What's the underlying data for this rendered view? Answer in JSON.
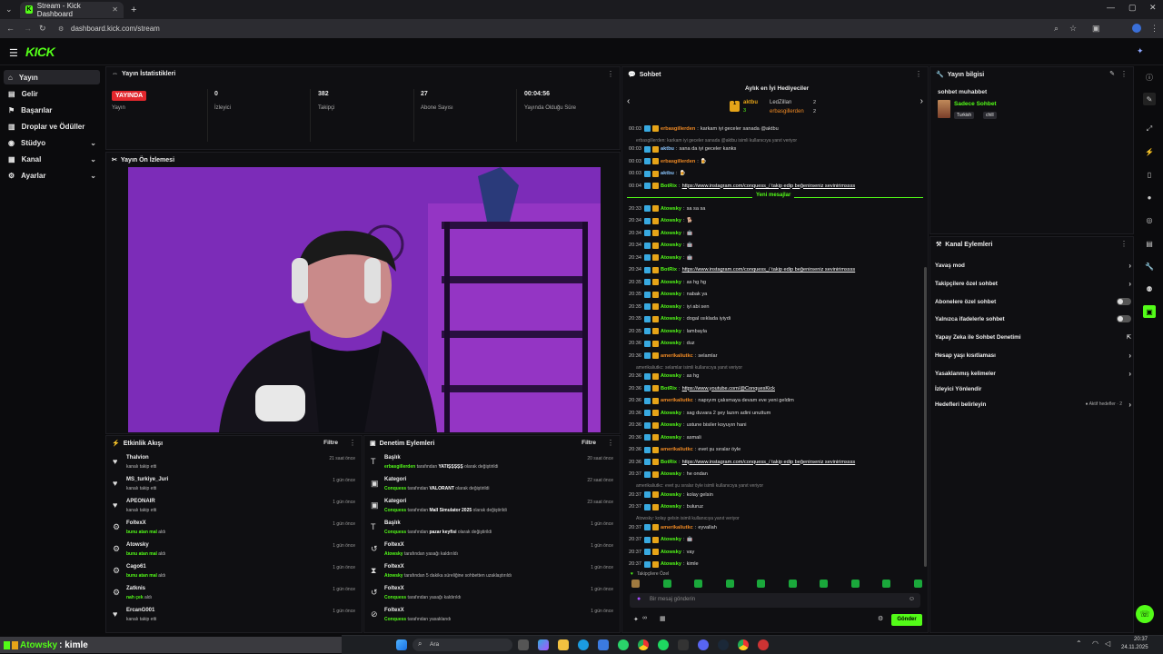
{
  "browser": {
    "tab_title": "Stream - Kick Dashboard",
    "url": "dashboard.kick.com/stream",
    "new_tab": "+"
  },
  "logo": "KICK",
  "sidebar": {
    "items": [
      {
        "label": "Yayın",
        "icon": "broadcast-icon"
      },
      {
        "label": "Gelir",
        "icon": "money-icon"
      },
      {
        "label": "Başarılar",
        "icon": "flag-icon"
      },
      {
        "label": "Droplar ve Ödüller",
        "icon": "gift-icon"
      },
      {
        "label": "Stüdyo",
        "icon": "studio-icon"
      },
      {
        "label": "Kanal",
        "icon": "channel-icon"
      },
      {
        "label": "Ayarlar",
        "icon": "settings-icon"
      }
    ]
  },
  "stats": {
    "title": "Yayın İstatistikleri",
    "live_badge": "YAYINDA",
    "items": [
      {
        "value": "",
        "label": "Yayın"
      },
      {
        "value": "0",
        "label": "İzleyici"
      },
      {
        "value": "382",
        "label": "Takipçi"
      },
      {
        "value": "27",
        "label": "Abone Sayısı"
      },
      {
        "value": "00:04:56",
        "label": "Yayında Olduğu Süre"
      }
    ]
  },
  "preview": {
    "title": "Yayın Ön İzlemesi"
  },
  "activity": {
    "title": "Etkinlik Akışı",
    "filter": "Filtre",
    "rows": [
      {
        "name": "Thalvion",
        "sub": "kanalı takip etti",
        "hl": "",
        "time": "21 saat önce",
        "icon": "♥"
      },
      {
        "name": "MS_turkiye_Juri",
        "sub": "kanalı takip etti",
        "hl": "",
        "time": "1 gün önce",
        "icon": "♥"
      },
      {
        "name": "APEONAIR",
        "sub": "kanalı takip etti",
        "hl": "",
        "time": "1 gün önce",
        "icon": "♥"
      },
      {
        "name": "FoltexX",
        "sub": " aldı",
        "hl": "bunu atan mal",
        "time": "1 gün önce",
        "icon": "⚙"
      },
      {
        "name": "Atowsky",
        "sub": " aldı",
        "hl": "bunu atan mal",
        "time": "1 gün önce",
        "icon": "⚙"
      },
      {
        "name": "Cago61",
        "sub": " aldı",
        "hl": "bunu atan mal",
        "time": "1 gün önce",
        "icon": "⚙"
      },
      {
        "name": "Zatknis",
        "sub": " aldı",
        "hl": "nah çek",
        "time": "1 gün önce",
        "icon": "⚙"
      },
      {
        "name": "ErcanG001",
        "sub": "kanalı takip etti",
        "hl": "",
        "time": "1 gün önce",
        "icon": "♥"
      }
    ]
  },
  "moderation": {
    "title": "Denetim Eylemleri",
    "filter": "Filtre",
    "rows": [
      {
        "name": "Başlık",
        "who": "erbasgillerden",
        "mid": " tarafından ",
        "val": "YATIŞŞŞŞŞ",
        "end": " olarak değiştirildi",
        "time": "20 saat önce",
        "icon": "T"
      },
      {
        "name": "Kategori",
        "who": "Conquess",
        "mid": " tarafından ",
        "val": "VALORANT",
        "end": " olarak değiştirildi",
        "time": "22 saat önce",
        "icon": "▣"
      },
      {
        "name": "Kategori",
        "who": "Conquess",
        "mid": " tarafından ",
        "val": "Mall Simulator 2025",
        "end": " olarak değiştirildi",
        "time": "23 saat önce",
        "icon": "▣"
      },
      {
        "name": "Başlık",
        "who": "Conquess",
        "mid": " tarafından ",
        "val": "pazar keyfisi",
        "end": " olarak değiştirildi",
        "time": "1 gün önce",
        "icon": "T"
      },
      {
        "name": "FoltexX",
        "who": "Atowsky",
        "mid": " tarafından yasağı kaldırıldı",
        "val": "",
        "end": "",
        "time": "1 gün önce",
        "icon": "↺"
      },
      {
        "name": "FoltexX",
        "who": "Atowsky",
        "mid": " tarafından 5 dakika süreliğine sohbetten uzaklaştırıldı",
        "val": "",
        "end": "",
        "time": "1 gün önce",
        "icon": "⧗"
      },
      {
        "name": "FoltexX",
        "who": "Conquess",
        "mid": " tarafından yasağı kaldırıldı",
        "val": "",
        "end": "",
        "time": "1 gün önce",
        "icon": "↺"
      },
      {
        "name": "FoltexX",
        "who": "Conquess",
        "mid": " tarafından yasaklandı",
        "val": "",
        "end": "",
        "time": "1 gün önce",
        "icon": "⊘"
      }
    ]
  },
  "chat": {
    "title": "Sohbet",
    "gifters_title": "Aylık en İyi Hediyeciler",
    "gifters": [
      {
        "name": "aktbu",
        "count": "3"
      },
      {
        "name": "LedZillan",
        "count": "2"
      },
      {
        "name": "erbasgillerden",
        "count": "2"
      }
    ],
    "new_messages": "Yeni mesajlar",
    "lines": [
      {
        "t": "00:03",
        "u": "erbasgillerden",
        "c": "o",
        "m": "karkam iyi geceler sanada @aktbu"
      },
      {
        "sys": "erbasgillerden: karkam iyi geceler sanada @aktbu isimli kullanıcıya yanıt veriyor"
      },
      {
        "t": "00:03",
        "u": "aktbu",
        "c": "b",
        "m": "sana da iyi geceler kanks"
      },
      {
        "t": "00:03",
        "u": "erbasgillerden",
        "c": "o",
        "m": "🍺"
      },
      {
        "t": "00:03",
        "u": "aktbu",
        "c": "b",
        "m": "🍺"
      },
      {
        "t": "00:04",
        "u": "BotRix",
        "c": "g",
        "m": "https://www.instagram.com/conquess_/ takip edip beğenirseniz sevinirimssss",
        "link": true
      },
      {
        "t": "20:33",
        "u": "Atowsky",
        "c": "g",
        "m": "sa sa sa"
      },
      {
        "t": "20:34",
        "u": "Atowsky",
        "c": "g",
        "m": "🐕"
      },
      {
        "t": "20:34",
        "u": "Atowsky",
        "c": "g",
        "m": "🤖"
      },
      {
        "t": "20:34",
        "u": "Atowsky",
        "c": "g",
        "m": "🤖"
      },
      {
        "t": "20:34",
        "u": "Atowsky",
        "c": "g",
        "m": "🤖"
      },
      {
        "t": "20:34",
        "u": "BotRix",
        "c": "g",
        "m": "https://www.instagram.com/conquess_/ takip edip beğenirseniz sevinirimssss",
        "link": true
      },
      {
        "t": "20:35",
        "u": "Atowsky",
        "c": "g",
        "m": "as hg hg"
      },
      {
        "t": "20:35",
        "u": "Atowsky",
        "c": "g",
        "m": "nabak ya"
      },
      {
        "t": "20:35",
        "u": "Atowsky",
        "c": "g",
        "m": "iyi abi sen"
      },
      {
        "t": "20:35",
        "u": "Atowsky",
        "c": "g",
        "m": "dogal ısıklada iyiydi"
      },
      {
        "t": "20:35",
        "u": "Atowsky",
        "c": "g",
        "m": "lambayla"
      },
      {
        "t": "20:36",
        "u": "Atowsky",
        "c": "g",
        "m": "duz"
      },
      {
        "t": "20:36",
        "u": "amerikaliutkc",
        "c": "o",
        "m": "selamlar"
      },
      {
        "sys": "amerikaliutkc: selamlar isimli kullanıcıya yanıt veriyor"
      },
      {
        "t": "20:36",
        "u": "Atowsky",
        "c": "g",
        "m": "as hg"
      },
      {
        "t": "20:36",
        "u": "BotRix",
        "c": "g",
        "m": "https://www.youtube.com/@ConquesKick",
        "link": true
      },
      {
        "t": "20:36",
        "u": "amerikaliutkc",
        "c": "o",
        "m": "napıyım çalısmaya devam eve yeni geldim"
      },
      {
        "t": "20:36",
        "u": "Atowsky",
        "c": "g",
        "m": "sag duvara 2 şey lazım adini unuttum"
      },
      {
        "t": "20:36",
        "u": "Atowsky",
        "c": "g",
        "m": "ustune bisiler koyuyın hani"
      },
      {
        "t": "20:36",
        "u": "Atowsky",
        "c": "g",
        "m": "asmali"
      },
      {
        "t": "20:36",
        "u": "amerikaliutkc",
        "c": "o",
        "m": "evet şu sıralar öyle"
      },
      {
        "t": "20:36",
        "u": "BotRix",
        "c": "g",
        "m": "https://www.instagram.com/conquess_/ takip edip beğenirseniz sevinirimssss",
        "link": true
      },
      {
        "t": "20:37",
        "u": "Atowsky",
        "c": "g",
        "m": "he ondan"
      },
      {
        "sys": "amerikaliutkc: evet şu sıralar öyle isimli kullanıcıya yanıt veriyor"
      },
      {
        "t": "20:37",
        "u": "Atowsky",
        "c": "g",
        "m": "kolay gelsin"
      },
      {
        "t": "20:37",
        "u": "Atowsky",
        "c": "g",
        "m": "buluruz"
      },
      {
        "sys": "Atowsky: kolay gelsin isimli kullanıcıya yanıt veriyor"
      },
      {
        "t": "20:37",
        "u": "amerikaliutkc",
        "c": "o",
        "m": "eyvallah"
      },
      {
        "t": "20:37",
        "u": "Atowsky",
        "c": "g",
        "m": "🤖"
      },
      {
        "t": "20:37",
        "u": "Atowsky",
        "c": "g",
        "m": "vay"
      },
      {
        "t": "20:37",
        "u": "Atowsky",
        "c": "g",
        "m": "kimle"
      }
    ],
    "followers_only": "Takipçilere Özel",
    "input_placeholder": "Bir mesaj gönderin",
    "send": "Gönder",
    "points": "∞"
  },
  "stream_info": {
    "title": "Yayın bilgisi",
    "stream_title": "sohbet muhabbet",
    "category": "Sadece Sohbet",
    "tags": [
      "Turkish",
      "chill"
    ]
  },
  "channel_actions": {
    "title": "Kanal Eylemleri",
    "items": [
      {
        "label": "Yavaş mod",
        "kind": "arrow"
      },
      {
        "label": "Takipçilere özel sohbet",
        "kind": "arrow"
      },
      {
        "label": "Abonelere özel sohbet",
        "kind": "toggle"
      },
      {
        "label": "Yalnızca ifadelerle sohbet",
        "kind": "toggle"
      },
      {
        "label": "Yapay Zeka ile Sohbet Denetimi",
        "kind": "ext"
      },
      {
        "label": "Hesap yaşı kısıtlaması",
        "kind": "arrow"
      },
      {
        "label": "Yasaklanmış kelimeler",
        "kind": "arrow"
      },
      {
        "label": "İzleyici Yönlendir",
        "kind": "none"
      },
      {
        "label": "Hedefleri belirleyin",
        "kind": "arrow",
        "badge": "● Aktif hedefler · 2"
      }
    ]
  },
  "overlay_text": {
    "user": "Atowsky",
    "msg": ": kimle"
  },
  "taskbar": {
    "search": "Ara",
    "time": "20:37",
    "date": "24.11.2025"
  },
  "colors": {
    "accent": "#53fc18",
    "live": "#e2272d"
  }
}
